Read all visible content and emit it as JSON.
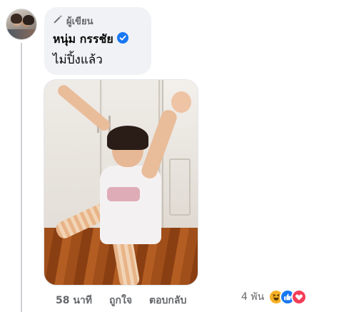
{
  "comment": {
    "author_badge": "ผู้เขียน",
    "author_name": "หนุ่ม กรรชัย",
    "text": "ไม่ปิ้งแล้ว"
  },
  "photo": {
    "alt": "photo"
  },
  "actions": {
    "time": "58 นาที",
    "like_label": "ถูกใจ",
    "reply_label": "ตอบกลับ"
  },
  "reactions": {
    "count": "4 พัน",
    "icons": [
      "haha-icon",
      "like-icon",
      "love-icon"
    ]
  },
  "colors": {
    "bubble_bg": "#f0f2f5",
    "secondary_text": "#65676b",
    "verified_blue": "#1877f2",
    "haha": "#f7b125",
    "like": "#1877f2",
    "love": "#f33e58"
  }
}
